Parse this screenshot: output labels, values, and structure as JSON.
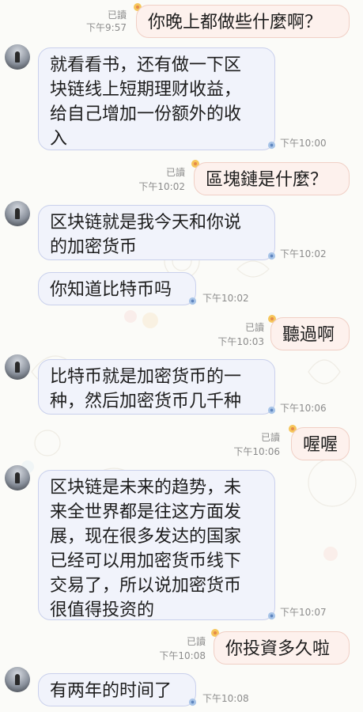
{
  "messages": [
    {
      "id": "m1",
      "side": "out",
      "text": "你晚上都做些什麼啊？",
      "read": "已讀",
      "time": "下午9:57"
    },
    {
      "id": "m2",
      "side": "in",
      "text": "就看看书，还有做一下区\n块链线上短期理财收益，\n给自己增加一份额外的收\n入",
      "time": "下午10:00"
    },
    {
      "id": "m3",
      "side": "out",
      "text": "區塊鏈是什麼？",
      "read": "已讀",
      "time": "下午10:02"
    },
    {
      "id": "m4",
      "side": "in",
      "text": "区块链就是我今天和你说\n的加密货币",
      "time": "下午10:02"
    },
    {
      "id": "m5",
      "side": "in",
      "text": "你知道比特币吗",
      "time": "下午10:02"
    },
    {
      "id": "m6",
      "side": "out",
      "text": "聽過啊",
      "read": "已讀",
      "time": "下午10:03"
    },
    {
      "id": "m7",
      "side": "in",
      "text": "比特币就是加密货币的一\n种，然后加密货币几千种",
      "time": "下午10:06"
    },
    {
      "id": "m8",
      "side": "out",
      "text": "喔喔",
      "read": "已讀",
      "time": "下午10:06"
    },
    {
      "id": "m9",
      "side": "in",
      "text": "区块链是未来的趋势，未\n来全世界都是往这方面发\n展，现在很多发达的国家\n已经可以用加密货币线下\n交易了，所以说加密货币\n很值得投资的",
      "time": "下午10:07"
    },
    {
      "id": "m10",
      "side": "out",
      "text": "你投資多久啦",
      "read": "已讀",
      "time": "下午10:08"
    },
    {
      "id": "m11",
      "side": "in",
      "text": "有两年的时间了",
      "time": "下午10:08"
    }
  ],
  "colors": {
    "out_bubble": "#fdf1ed",
    "in_bubble": "#f1f3fb",
    "out_border": "#f0cfc5",
    "in_border": "#c9d0ec"
  },
  "icons": {
    "out_deco": "flower-badge-icon",
    "in_deco": "pin-badge-icon"
  }
}
